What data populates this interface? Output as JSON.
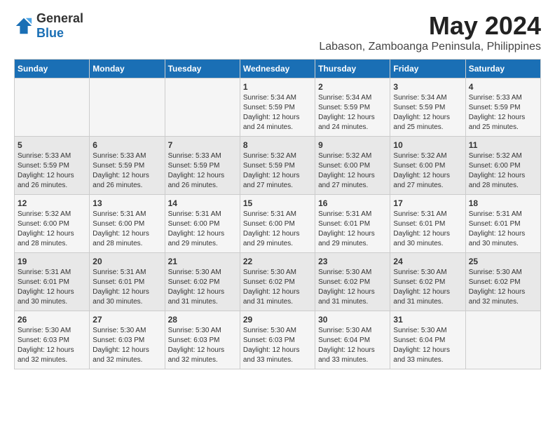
{
  "logo": {
    "general": "General",
    "blue": "Blue"
  },
  "title": "May 2024",
  "subtitle": "Labason, Zamboanga Peninsula, Philippines",
  "weekdays": [
    "Sunday",
    "Monday",
    "Tuesday",
    "Wednesday",
    "Thursday",
    "Friday",
    "Saturday"
  ],
  "weeks": [
    [
      {
        "day": "",
        "info": ""
      },
      {
        "day": "",
        "info": ""
      },
      {
        "day": "",
        "info": ""
      },
      {
        "day": "1",
        "info": "Sunrise: 5:34 AM\nSunset: 5:59 PM\nDaylight: 12 hours\nand 24 minutes."
      },
      {
        "day": "2",
        "info": "Sunrise: 5:34 AM\nSunset: 5:59 PM\nDaylight: 12 hours\nand 24 minutes."
      },
      {
        "day": "3",
        "info": "Sunrise: 5:34 AM\nSunset: 5:59 PM\nDaylight: 12 hours\nand 25 minutes."
      },
      {
        "day": "4",
        "info": "Sunrise: 5:33 AM\nSunset: 5:59 PM\nDaylight: 12 hours\nand 25 minutes."
      }
    ],
    [
      {
        "day": "5",
        "info": "Sunrise: 5:33 AM\nSunset: 5:59 PM\nDaylight: 12 hours\nand 26 minutes."
      },
      {
        "day": "6",
        "info": "Sunrise: 5:33 AM\nSunset: 5:59 PM\nDaylight: 12 hours\nand 26 minutes."
      },
      {
        "day": "7",
        "info": "Sunrise: 5:33 AM\nSunset: 5:59 PM\nDaylight: 12 hours\nand 26 minutes."
      },
      {
        "day": "8",
        "info": "Sunrise: 5:32 AM\nSunset: 5:59 PM\nDaylight: 12 hours\nand 27 minutes."
      },
      {
        "day": "9",
        "info": "Sunrise: 5:32 AM\nSunset: 6:00 PM\nDaylight: 12 hours\nand 27 minutes."
      },
      {
        "day": "10",
        "info": "Sunrise: 5:32 AM\nSunset: 6:00 PM\nDaylight: 12 hours\nand 27 minutes."
      },
      {
        "day": "11",
        "info": "Sunrise: 5:32 AM\nSunset: 6:00 PM\nDaylight: 12 hours\nand 28 minutes."
      }
    ],
    [
      {
        "day": "12",
        "info": "Sunrise: 5:32 AM\nSunset: 6:00 PM\nDaylight: 12 hours\nand 28 minutes."
      },
      {
        "day": "13",
        "info": "Sunrise: 5:31 AM\nSunset: 6:00 PM\nDaylight: 12 hours\nand 28 minutes."
      },
      {
        "day": "14",
        "info": "Sunrise: 5:31 AM\nSunset: 6:00 PM\nDaylight: 12 hours\nand 29 minutes."
      },
      {
        "day": "15",
        "info": "Sunrise: 5:31 AM\nSunset: 6:00 PM\nDaylight: 12 hours\nand 29 minutes."
      },
      {
        "day": "16",
        "info": "Sunrise: 5:31 AM\nSunset: 6:01 PM\nDaylight: 12 hours\nand 29 minutes."
      },
      {
        "day": "17",
        "info": "Sunrise: 5:31 AM\nSunset: 6:01 PM\nDaylight: 12 hours\nand 30 minutes."
      },
      {
        "day": "18",
        "info": "Sunrise: 5:31 AM\nSunset: 6:01 PM\nDaylight: 12 hours\nand 30 minutes."
      }
    ],
    [
      {
        "day": "19",
        "info": "Sunrise: 5:31 AM\nSunset: 6:01 PM\nDaylight: 12 hours\nand 30 minutes."
      },
      {
        "day": "20",
        "info": "Sunrise: 5:31 AM\nSunset: 6:01 PM\nDaylight: 12 hours\nand 30 minutes."
      },
      {
        "day": "21",
        "info": "Sunrise: 5:30 AM\nSunset: 6:02 PM\nDaylight: 12 hours\nand 31 minutes."
      },
      {
        "day": "22",
        "info": "Sunrise: 5:30 AM\nSunset: 6:02 PM\nDaylight: 12 hours\nand 31 minutes."
      },
      {
        "day": "23",
        "info": "Sunrise: 5:30 AM\nSunset: 6:02 PM\nDaylight: 12 hours\nand 31 minutes."
      },
      {
        "day": "24",
        "info": "Sunrise: 5:30 AM\nSunset: 6:02 PM\nDaylight: 12 hours\nand 31 minutes."
      },
      {
        "day": "25",
        "info": "Sunrise: 5:30 AM\nSunset: 6:02 PM\nDaylight: 12 hours\nand 32 minutes."
      }
    ],
    [
      {
        "day": "26",
        "info": "Sunrise: 5:30 AM\nSunset: 6:03 PM\nDaylight: 12 hours\nand 32 minutes."
      },
      {
        "day": "27",
        "info": "Sunrise: 5:30 AM\nSunset: 6:03 PM\nDaylight: 12 hours\nand 32 minutes."
      },
      {
        "day": "28",
        "info": "Sunrise: 5:30 AM\nSunset: 6:03 PM\nDaylight: 12 hours\nand 32 minutes."
      },
      {
        "day": "29",
        "info": "Sunrise: 5:30 AM\nSunset: 6:03 PM\nDaylight: 12 hours\nand 33 minutes."
      },
      {
        "day": "30",
        "info": "Sunrise: 5:30 AM\nSunset: 6:04 PM\nDaylight: 12 hours\nand 33 minutes."
      },
      {
        "day": "31",
        "info": "Sunrise: 5:30 AM\nSunset: 6:04 PM\nDaylight: 12 hours\nand 33 minutes."
      },
      {
        "day": "",
        "info": ""
      }
    ]
  ]
}
